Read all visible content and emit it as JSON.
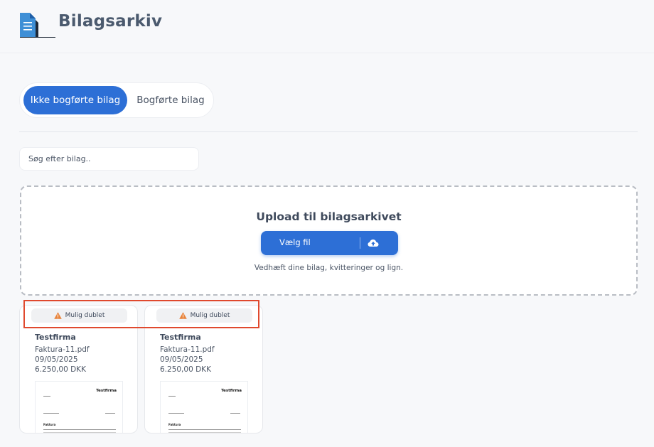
{
  "app": {
    "title": "Bilagsarkiv",
    "logo_icon": "document-icon",
    "accent_color": "#2d6fd6"
  },
  "tabs": [
    {
      "label": "Ikke bogførte bilag",
      "active": true
    },
    {
      "label": "Bogførte bilag",
      "active": false
    }
  ],
  "search": {
    "placeholder": "Søg efter bilag..",
    "value": ""
  },
  "upload": {
    "title": "Upload til bilagsarkivet",
    "button_label": "Vælg fil",
    "button_icon": "cloud-upload-icon",
    "hint": "Vedhæft dine bilag, kvitteringer og lign."
  },
  "cards": [
    {
      "badge": "Mulig dublet",
      "badge_icon": "warning-icon",
      "badge_icon_color": "#e8833a",
      "company": "Testfirma",
      "filename": "Faktura-11.pdf",
      "date": "09/05/2025",
      "amount": "6.250,00 DKK",
      "preview": {
        "company": "Testfirma",
        "heading": "Faktura"
      }
    },
    {
      "badge": "Mulig dublet",
      "badge_icon": "warning-icon",
      "badge_icon_color": "#e8833a",
      "company": "Testfirma",
      "filename": "Faktura-11.pdf",
      "date": "09/05/2025",
      "amount": "6.250,00 DKK",
      "preview": {
        "company": "Testfirma",
        "heading": "Faktura"
      }
    }
  ]
}
